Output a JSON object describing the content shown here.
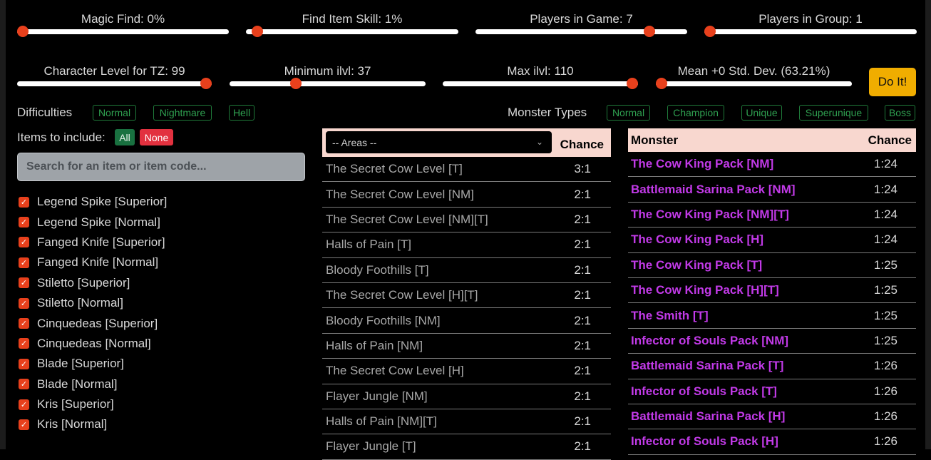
{
  "sliders": [
    {
      "label": "Magic Find: 0%",
      "level": 0
    },
    {
      "label": "Find Item Skill: 1%",
      "level": 0.03
    },
    {
      "label": "Players in Game: 7",
      "level": 0.84
    },
    {
      "label": "Players in Group: 1",
      "level": 0
    },
    {
      "label": "Character Level for TZ: 99",
      "level": 1
    },
    {
      "label": "Minimum ilvl: 37",
      "level": 0.33
    },
    {
      "label": "Max ilvl: 110",
      "level": 1
    },
    {
      "label": "Mean +0 Std. Dev. (63.21%)",
      "level": 0
    }
  ],
  "do_it_label": "Do It!",
  "difficulties": {
    "label": "Difficulties",
    "options": [
      "Normal",
      "Nightmare",
      "Hell"
    ]
  },
  "monster_types": {
    "label": "Monster Types",
    "options": [
      "Normal",
      "Champion",
      "Unique",
      "Superunique",
      "Boss"
    ]
  },
  "items_filter": {
    "label": "Items to include:",
    "all_label": "All",
    "none_label": "None",
    "search_placeholder": "Search for an item or item code...",
    "items": [
      "Legend Spike [Superior]",
      "Legend Spike [Normal]",
      "Fanged Knife [Superior]",
      "Fanged Knife [Normal]",
      "Stiletto [Superior]",
      "Stiletto [Normal]",
      "Cinquedeas [Superior]",
      "Cinquedeas [Normal]",
      "Blade [Superior]",
      "Blade [Normal]",
      "Kris [Superior]",
      "Kris [Normal]"
    ]
  },
  "areas_table": {
    "select_value": "-- Areas --",
    "chance_header": "Chance",
    "rows": [
      {
        "area": "The Secret Cow Level [T]",
        "chance": "3:1"
      },
      {
        "area": "The Secret Cow Level [NM]",
        "chance": "2:1"
      },
      {
        "area": "The Secret Cow Level [NM][T]",
        "chance": "2:1"
      },
      {
        "area": "Halls of Pain [T]",
        "chance": "2:1"
      },
      {
        "area": "Bloody Foothills [T]",
        "chance": "2:1"
      },
      {
        "area": "The Secret Cow Level [H][T]",
        "chance": "2:1"
      },
      {
        "area": "Bloody Foothills [NM]",
        "chance": "2:1"
      },
      {
        "area": "Halls of Pain [NM]",
        "chance": "2:1"
      },
      {
        "area": "The Secret Cow Level [H]",
        "chance": "2:1"
      },
      {
        "area": "Flayer Jungle [NM]",
        "chance": "2:1"
      },
      {
        "area": "Halls of Pain [NM][T]",
        "chance": "2:1"
      },
      {
        "area": "Flayer Jungle [T]",
        "chance": "2:1"
      }
    ]
  },
  "monsters_table": {
    "monster_header": "Monster",
    "chance_header": "Chance",
    "rows": [
      {
        "monster": "The Cow King Pack [NM]",
        "chance": "1:24"
      },
      {
        "monster": "Battlemaid Sarina Pack [NM]",
        "chance": "1:24"
      },
      {
        "monster": "The Cow King Pack [NM][T]",
        "chance": "1:24"
      },
      {
        "monster": "The Cow King Pack [H]",
        "chance": "1:24"
      },
      {
        "monster": "The Cow King Pack [T]",
        "chance": "1:25"
      },
      {
        "monster": "The Cow King Pack [H][T]",
        "chance": "1:25"
      },
      {
        "monster": "The Smith [T]",
        "chance": "1:25"
      },
      {
        "monster": "Infector of Souls Pack [NM]",
        "chance": "1:25"
      },
      {
        "monster": "Battlemaid Sarina Pack [T]",
        "chance": "1:26"
      },
      {
        "monster": "Infector of Souls Pack [T]",
        "chance": "1:26"
      },
      {
        "monster": "Battlemaid Sarina Pack [H]",
        "chance": "1:26"
      },
      {
        "monster": "Infector of Souls Pack [H]",
        "chance": "1:26"
      }
    ]
  },
  "colors": {
    "slider_thumb": "#e8401c",
    "do_it": "#f0ad00",
    "monster_name": "#c23ae8",
    "table_header": "#f8d7cf",
    "tag_green": "#2fa050"
  }
}
